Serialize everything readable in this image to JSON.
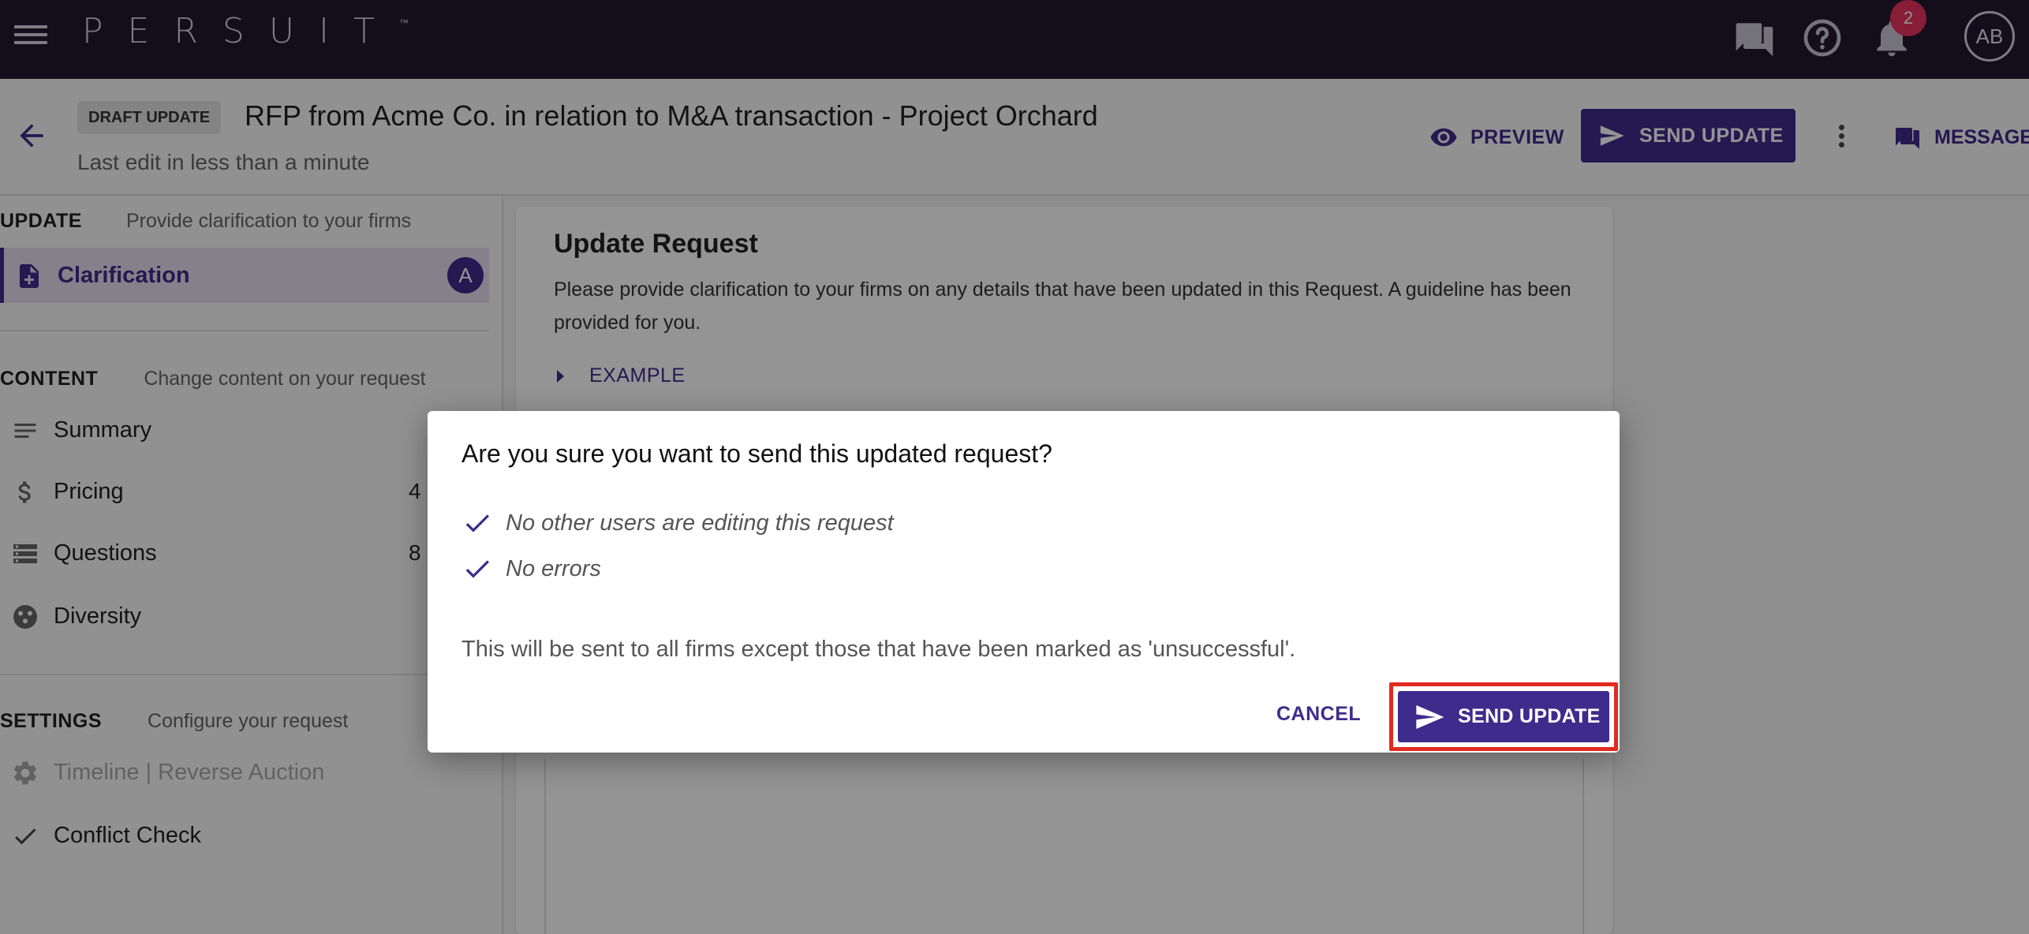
{
  "topbar": {
    "logo_text": "PERSUIT",
    "logo_tm": "™",
    "notification_count": "2",
    "avatar_initials": "AB",
    "icons": [
      "menu-icon",
      "chat-icon",
      "help-icon",
      "bell-icon"
    ]
  },
  "request_header": {
    "badge": "DRAFT UPDATE",
    "title": "RFP from Acme Co. in relation to M&A transaction - Project Orchard",
    "last_edit": "Last edit in less than a minute",
    "preview_label": "PREVIEW",
    "send_update_label": "SEND UPDATE",
    "messages_label": "MESSAGES"
  },
  "sidebar": {
    "update_section": {
      "key": "UPDATE",
      "desc": "Provide clarification to your firms"
    },
    "update_items": [
      {
        "label": "Clarification",
        "badge": "A",
        "icon": "add-document-icon"
      }
    ],
    "content_section": {
      "key": "CONTENT",
      "desc": "Change content on your request"
    },
    "content_items": [
      {
        "label": "Summary",
        "count": "",
        "icon": "lines-icon"
      },
      {
        "label": "Pricing",
        "count": "4",
        "icon": "dollar-icon"
      },
      {
        "label": "Questions",
        "count": "8",
        "icon": "storage-icon"
      },
      {
        "label": "Diversity",
        "count": "",
        "icon": "diversity-icon"
      }
    ],
    "settings_section": {
      "key": "SETTINGS",
      "desc": "Configure your request"
    },
    "settings_items": [
      {
        "label": "Timeline | Reverse Auction",
        "icon": "gear-icon",
        "disabled": true
      },
      {
        "label": "Conflict Check",
        "icon": "check-icon",
        "disabled": false
      }
    ]
  },
  "main": {
    "heading": "Update Request",
    "description": "Please provide clarification to your firms on any details that have been updated in this Request. A guideline has been provided for you.",
    "example_label": "EXAMPLE"
  },
  "dialog": {
    "title": "Are you sure you want to send this updated request?",
    "checks": [
      "No other users are editing this request",
      "No errors"
    ],
    "note": "This will be sent to all firms except those that have been marked as 'unsuccessful'.",
    "cancel_label": "CANCEL",
    "send_label": "SEND UPDATE"
  },
  "colors": {
    "topbar_bg": "#211831",
    "accent": "#3e2c8c",
    "badge_red": "#e8335e",
    "highlight_border": "#e12a1f"
  }
}
